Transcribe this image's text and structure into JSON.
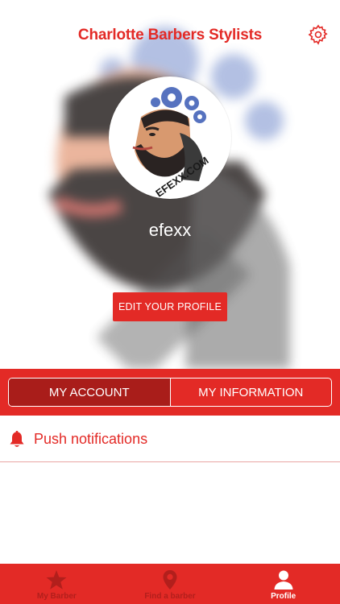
{
  "app": {
    "title": "Charlotte Barbers Stylists"
  },
  "profile": {
    "username": "efexx",
    "avatar_text": "EFEXX.COM",
    "edit_button": "EDIT YOUR PROFILE"
  },
  "segments": [
    {
      "label": "MY ACCOUNT",
      "active": true
    },
    {
      "label": "MY INFORMATION",
      "active": false
    }
  ],
  "settings_list": [
    {
      "icon": "bell-icon",
      "label": "Push notifications"
    }
  ],
  "tabbar": {
    "items": [
      {
        "icon": "star-icon",
        "label": "My Barber",
        "active": false
      },
      {
        "icon": "map-pin-icon",
        "label": "Find a barber",
        "active": false
      },
      {
        "icon": "person-icon",
        "label": "Profile",
        "active": true
      }
    ]
  },
  "colors": {
    "accent": "#e32a26",
    "accent_dark": "#a91d1a",
    "inactive_tab_label": "#b21f1c",
    "white": "#ffffff"
  }
}
